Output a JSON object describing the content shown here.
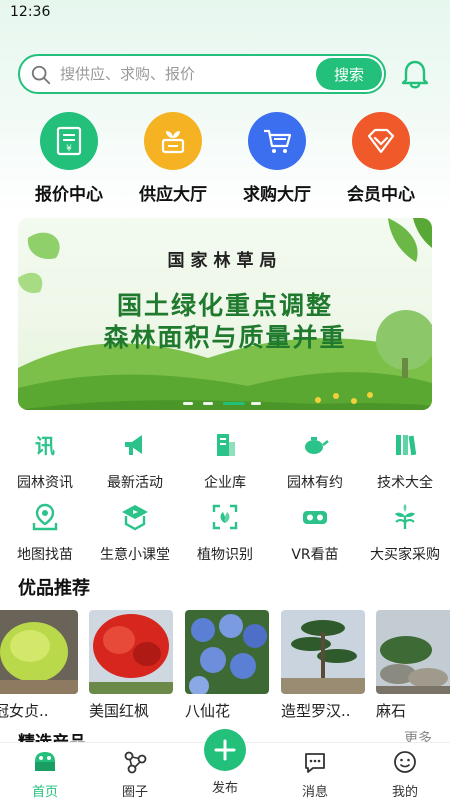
{
  "status_bar": {
    "time": "12:36"
  },
  "search": {
    "placeholder": "搜供应、求购、报价",
    "button_label": "搜索"
  },
  "main_nav": [
    {
      "label": "报价中心",
      "color": "#22c07a",
      "icon": "quote-doc-icon"
    },
    {
      "label": "供应大厅",
      "color": "#f5b324",
      "icon": "sprout-box-icon"
    },
    {
      "label": "求购大厅",
      "color": "#3b6ff0",
      "icon": "cart-icon"
    },
    {
      "label": "会员中心",
      "color": "#f05a2a",
      "icon": "diamond-icon"
    }
  ],
  "banner": {
    "org": "国家林草局",
    "line1": "国土绿化重点调整",
    "line2": "森林面积与质量并重"
  },
  "quick_grid": [
    {
      "label": "园林资讯",
      "icon": "news-icon"
    },
    {
      "label": "最新活动",
      "icon": "megaphone-icon"
    },
    {
      "label": "企业库",
      "icon": "building-icon"
    },
    {
      "label": "园林有约",
      "icon": "teapot-icon"
    },
    {
      "label": "技术大全",
      "icon": "books-icon"
    },
    {
      "label": "地图找苗",
      "icon": "map-pin-icon"
    },
    {
      "label": "生意小课堂",
      "icon": "video-class-icon"
    },
    {
      "label": "植物识别",
      "icon": "scan-plant-icon"
    },
    {
      "label": "VR看苗",
      "icon": "vr-icon"
    },
    {
      "label": "大买家采购",
      "icon": "tree-icon"
    }
  ],
  "featured": {
    "title": "优品推荐",
    "items": [
      {
        "name": "冠女贞..",
        "color": "#b9d84a"
      },
      {
        "name": "美国红枫",
        "color": "#d7261e"
      },
      {
        "name": "八仙花",
        "color": "#5a7fd4"
      },
      {
        "name": "造型罗汉..",
        "color": "#2f5a2c"
      },
      {
        "name": "麻石",
        "color": "#8a8a80"
      }
    ]
  },
  "selected_section": {
    "title": "精选产品",
    "more": "更多"
  },
  "tabbar": [
    {
      "label": "首页",
      "icon": "home-icon",
      "active": true
    },
    {
      "label": "圈子",
      "icon": "circle-network-icon",
      "active": false
    },
    {
      "label": "发布",
      "icon": "plus-icon",
      "active": false
    },
    {
      "label": "消息",
      "icon": "message-icon",
      "active": false
    },
    {
      "label": "我的",
      "icon": "profile-icon",
      "active": false
    }
  ],
  "colors": {
    "accent": "#22c07a"
  }
}
